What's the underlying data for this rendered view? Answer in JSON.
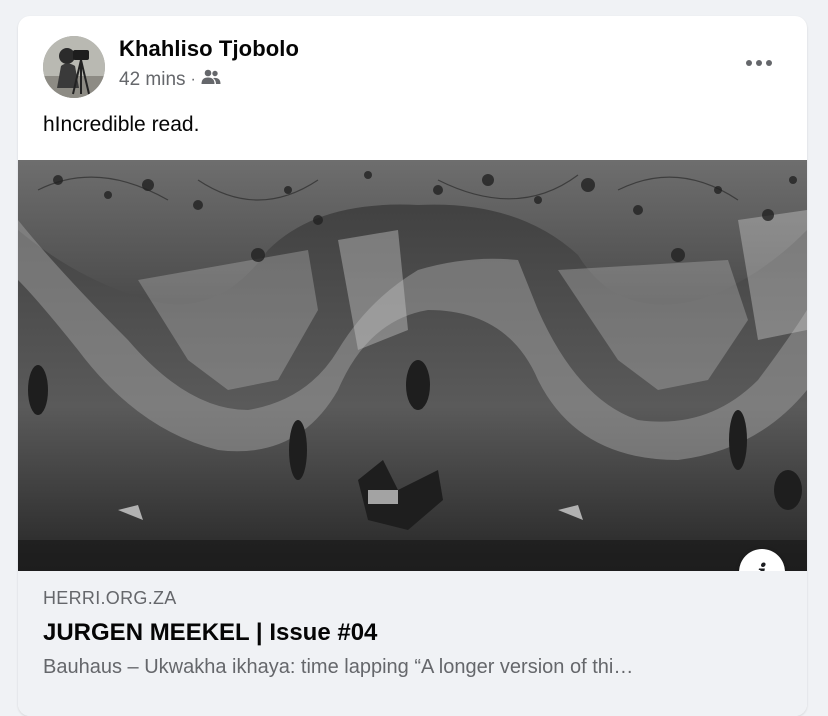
{
  "post": {
    "author": "Khahliso Tjobolo",
    "timestamp": "42 mins",
    "separator": "·",
    "audience_icon": "friends-icon",
    "text": "hIncredible read.",
    "more_icon": "more-options-icon"
  },
  "link_preview": {
    "domain": "HERRI.ORG.ZA",
    "title": "JURGEN MEEKEL | Issue #04",
    "description": "Bauhaus – Ukwakha ikhaya: time lapping “A longer version of thi…",
    "info_icon": "info-icon",
    "info_glyph": "i"
  },
  "colors": {
    "background": "#f0f2f5",
    "card": "#ffffff",
    "primary_text": "#050505",
    "secondary_text": "#65676b"
  }
}
